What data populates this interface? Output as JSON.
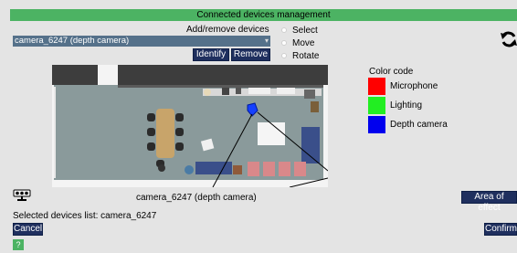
{
  "header": {
    "title": "Connected devices management"
  },
  "add_remove": {
    "label": "Add/remove devices",
    "selected_device": "camera_6247 (depth camera)",
    "identify_label": "Identify",
    "remove_label": "Remove"
  },
  "modes": [
    {
      "label": "Select"
    },
    {
      "label": "Move"
    },
    {
      "label": "Rotate"
    }
  ],
  "legend": {
    "title": "Color code",
    "items": [
      {
        "label": "Microphone",
        "color": "#ff0000"
      },
      {
        "label": "Lighting",
        "color": "#22ee22"
      },
      {
        "label": "Depth camera",
        "color": "#0000ee"
      }
    ]
  },
  "device_info": {
    "name": "camera_6247 (depth camera)"
  },
  "area_of_effect_label": "Area of effect",
  "selected_devices": {
    "text": "Selected devices list:  camera_6247"
  },
  "cancel_label": "Cancel",
  "confirm_label": "Confirm",
  "help_label": "?",
  "icons": {
    "refresh": "refresh-icon",
    "camera": "depth-camera-icon",
    "marker": "camera-marker-icon"
  }
}
